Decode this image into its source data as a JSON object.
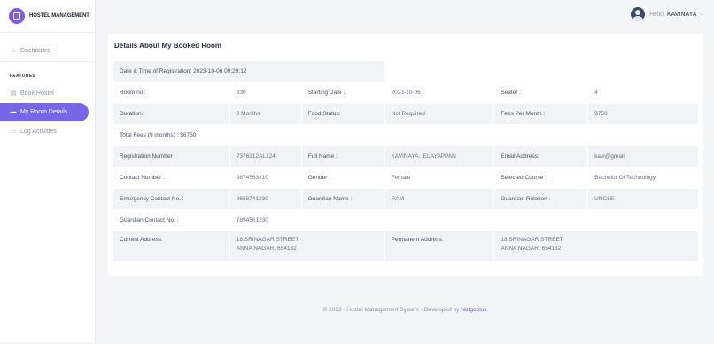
{
  "brand": {
    "name": "HOSTEL MANAGEMENT"
  },
  "sidebar": {
    "dashboard": "Dashboard",
    "section": "FEATURES",
    "items": [
      {
        "label": "Book Hostel",
        "icon": "building-icon"
      },
      {
        "label": "My Room Details",
        "icon": "bed-icon",
        "active": true
      },
      {
        "label": "Log Activities",
        "icon": "users-icon"
      }
    ]
  },
  "topbar": {
    "hello": "Hello,",
    "username": "KAVINAYA",
    "caret": "⌵"
  },
  "card": {
    "title": "Details About My Booked Room",
    "registration": "Date & Time of Registration: 2023-10-06 09:29:12",
    "room_no_label": "Room no :",
    "room_no": "330",
    "starting_date_label": "Starting Date :",
    "starting_date": "2023-10-06",
    "seater_label": "Seater :",
    "seater": "4",
    "duration_label": "Duration:",
    "duration": "9 Months",
    "food_status_label": "Food Status:",
    "food_status": "Not Required",
    "fees_label": "Fees Per Month :",
    "fees": "$750",
    "total_fees": "Total Fees (9 months) : $6750",
    "reg_no_label": "Registration Number :",
    "reg_no": "7376212AL124",
    "full_name_label": "Full Name :",
    "full_name": "KAVINAYA . ELAYAPPAN",
    "email_label": "Email Address:",
    "email": "kavi@gmail",
    "contact_label": "Contact Number :",
    "contact": "9874563210",
    "gender_label": "Gender :",
    "gender": "Female",
    "course_label": "Selected Course :",
    "course": "Bachelor Of Technology",
    "emergency_label": "Emergency Contact No. :",
    "emergency": "9658741230",
    "guardian_name_label": "Guardian Name :",
    "guardian_name": "RAM",
    "guardian_relation_label": "Guardian Relation :",
    "guardian_relation": "UNCLE",
    "guardian_contact_label": "Guardian Contact No. :",
    "guardian_contact": "7894561230",
    "current_address_label": "Current Address:",
    "current_address_line1": "18,SRINAGAR STREET",
    "current_address_line2": "ANNA NAGAR, 654132",
    "permanent_address_label": "Permanent Address:",
    "permanent_address_line1": "18,SRINAGAR STREET",
    "permanent_address_line2": "ANNA NAGAR, 654132"
  },
  "footer": {
    "text": "© 2023 - Hostel Management System - Developed by",
    "link": "Netgoplus"
  }
}
